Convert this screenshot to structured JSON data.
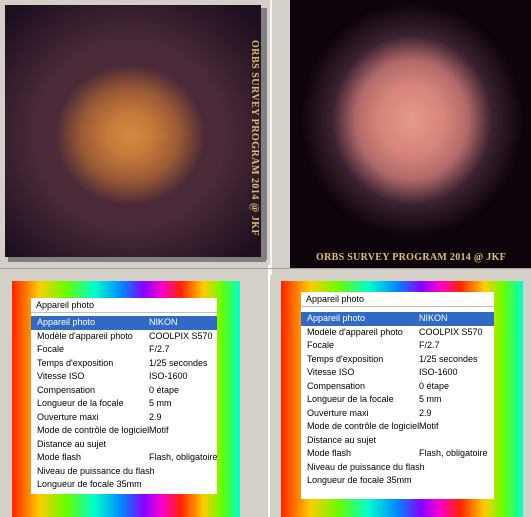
{
  "left_photo": {
    "watermark": "ORBS SURVEY PROGRAM 2014 @ JKF"
  },
  "right_photo": {
    "watermark": "ORBS SURVEY PROGRAM 2014 @ JKF"
  },
  "exif_left": {
    "title": "Appareil photo",
    "rows": [
      {
        "k": "Appareil photo",
        "v": "NIKON"
      },
      {
        "k": "Modèle d'appareil photo",
        "v": "COOLPIX S570"
      },
      {
        "k": "Focale",
        "v": "F/2.7"
      },
      {
        "k": "Temps d'exposition",
        "v": "1/25 secondes"
      },
      {
        "k": "Vitesse ISO",
        "v": "ISO-1600"
      },
      {
        "k": "Compensation",
        "v": "0 étape"
      },
      {
        "k": "Longueur de la focale",
        "v": "5 mm"
      },
      {
        "k": "Ouverture maxi",
        "v": "2.9"
      },
      {
        "k": "Mode de contrôle de logiciel",
        "v": "Motif"
      },
      {
        "k": "Distance au sujet",
        "v": ""
      },
      {
        "k": "Mode flash",
        "v": "Flash, obligatoire"
      },
      {
        "k": "Niveau de puissance du flash",
        "v": ""
      },
      {
        "k": "Longueur de focale 35mm",
        "v": ""
      }
    ]
  },
  "exif_right": {
    "title": "Appareil photo",
    "rows": [
      {
        "k": "Appareil photo",
        "v": "NIKON"
      },
      {
        "k": "Modèle d'appareil photo",
        "v": "COOLPIX S570"
      },
      {
        "k": "Focale",
        "v": "F/2.7"
      },
      {
        "k": "Temps d'exposition",
        "v": "1/25 secondes"
      },
      {
        "k": "Vitesse ISO",
        "v": "ISO-1600"
      },
      {
        "k": "Compensation",
        "v": "0 étape"
      },
      {
        "k": "Longueur de la focale",
        "v": "5 mm"
      },
      {
        "k": "Ouverture maxi",
        "v": "2.9"
      },
      {
        "k": "Mode de contrôle de logiciel",
        "v": "Motif"
      },
      {
        "k": "Distance au sujet",
        "v": ""
      },
      {
        "k": "Mode flash",
        "v": "Flash, obligatoire"
      },
      {
        "k": "Niveau de puissance du flash",
        "v": ""
      },
      {
        "k": "Longueur de focale 35mm",
        "v": ""
      }
    ]
  },
  "colors": {
    "selection": "#316ac5",
    "watermark": "#e0c070"
  }
}
